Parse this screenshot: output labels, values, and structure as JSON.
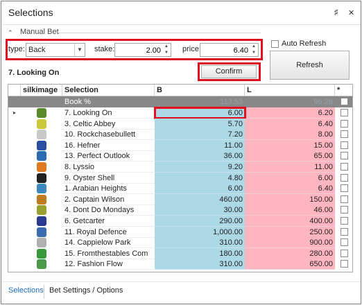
{
  "window": {
    "title": "Selections",
    "pin_icon": "pin-icon",
    "close_icon": "close-icon"
  },
  "manual_bet": {
    "legend": "Manual Bet",
    "type_label": "type:",
    "type_value": "Back",
    "stake_label": "stake:",
    "stake_value": "2.00",
    "price_label": "price:",
    "price_value": "6.40",
    "auto_refresh_label": "Auto Refresh",
    "auto_refresh_checked": false,
    "refresh_button": "Refresh",
    "confirm_button": "Confirm",
    "selected_runner": "7. Looking On"
  },
  "grid": {
    "columns": {
      "silk": "silkimage",
      "selection": "Selection",
      "back": "B",
      "lay": "L",
      "star": "*"
    },
    "book_row": {
      "selection": "Book %",
      "back": "113.53",
      "lay": "96.28"
    },
    "rows": [
      {
        "selection": "7. Looking On",
        "back": "6.00",
        "lay": "6.20",
        "silk_color": "#5a8a2a",
        "current": true
      },
      {
        "selection": "3. Celtic Abbey",
        "back": "5.70",
        "lay": "6.40",
        "silk_color": "#c9c93a"
      },
      {
        "selection": "10. Rockchasebullett",
        "back": "7.20",
        "lay": "8.00",
        "silk_color": "#c8c8c8"
      },
      {
        "selection": "16. Hefner",
        "back": "11.00",
        "lay": "15.00",
        "silk_color": "#2a4fa0"
      },
      {
        "selection": "13. Perfect Outlook",
        "back": "36.00",
        "lay": "65.00",
        "silk_color": "#2a6ab0"
      },
      {
        "selection": "8. Lyssio",
        "back": "9.20",
        "lay": "11.00",
        "silk_color": "#e07a20"
      },
      {
        "selection": "9. Oyster Shell",
        "back": "4.80",
        "lay": "6.00",
        "silk_color": "#222222"
      },
      {
        "selection": "1. Arabian Heights",
        "back": "6.00",
        "lay": "6.40",
        "silk_color": "#3a8ac0"
      },
      {
        "selection": "2. Captain Wilson",
        "back": "460.00",
        "lay": "150.00",
        "silk_color": "#c07a20"
      },
      {
        "selection": "4. Dont Do Mondays",
        "back": "30.00",
        "lay": "46.00",
        "silk_color": "#9aa030"
      },
      {
        "selection": "6. Getcarter",
        "back": "290.00",
        "lay": "400.00",
        "silk_color": "#2a3a90"
      },
      {
        "selection": "11. Royal Defence",
        "back": "1,000.00",
        "lay": "250.00",
        "silk_color": "#3a6ab0"
      },
      {
        "selection": "14. Cappielow Park",
        "back": "310.00",
        "lay": "900.00",
        "silk_color": "#b0b0b0"
      },
      {
        "selection": "15. Fromthestables Com",
        "back": "180.00",
        "lay": "280.00",
        "silk_color": "#3a9a3a"
      },
      {
        "selection": "12. Fashion Flow",
        "back": "310.00",
        "lay": "650.00",
        "silk_color": "#4a9a4a"
      }
    ]
  },
  "tabs": [
    {
      "label": "Selections",
      "active": true
    },
    {
      "label": "Bet Settings / Options",
      "active": false
    }
  ],
  "colors": {
    "back": "#add8e6",
    "lay": "#ffb6c1",
    "highlight": "#e01020",
    "active_tab": "#1e6fbf"
  }
}
